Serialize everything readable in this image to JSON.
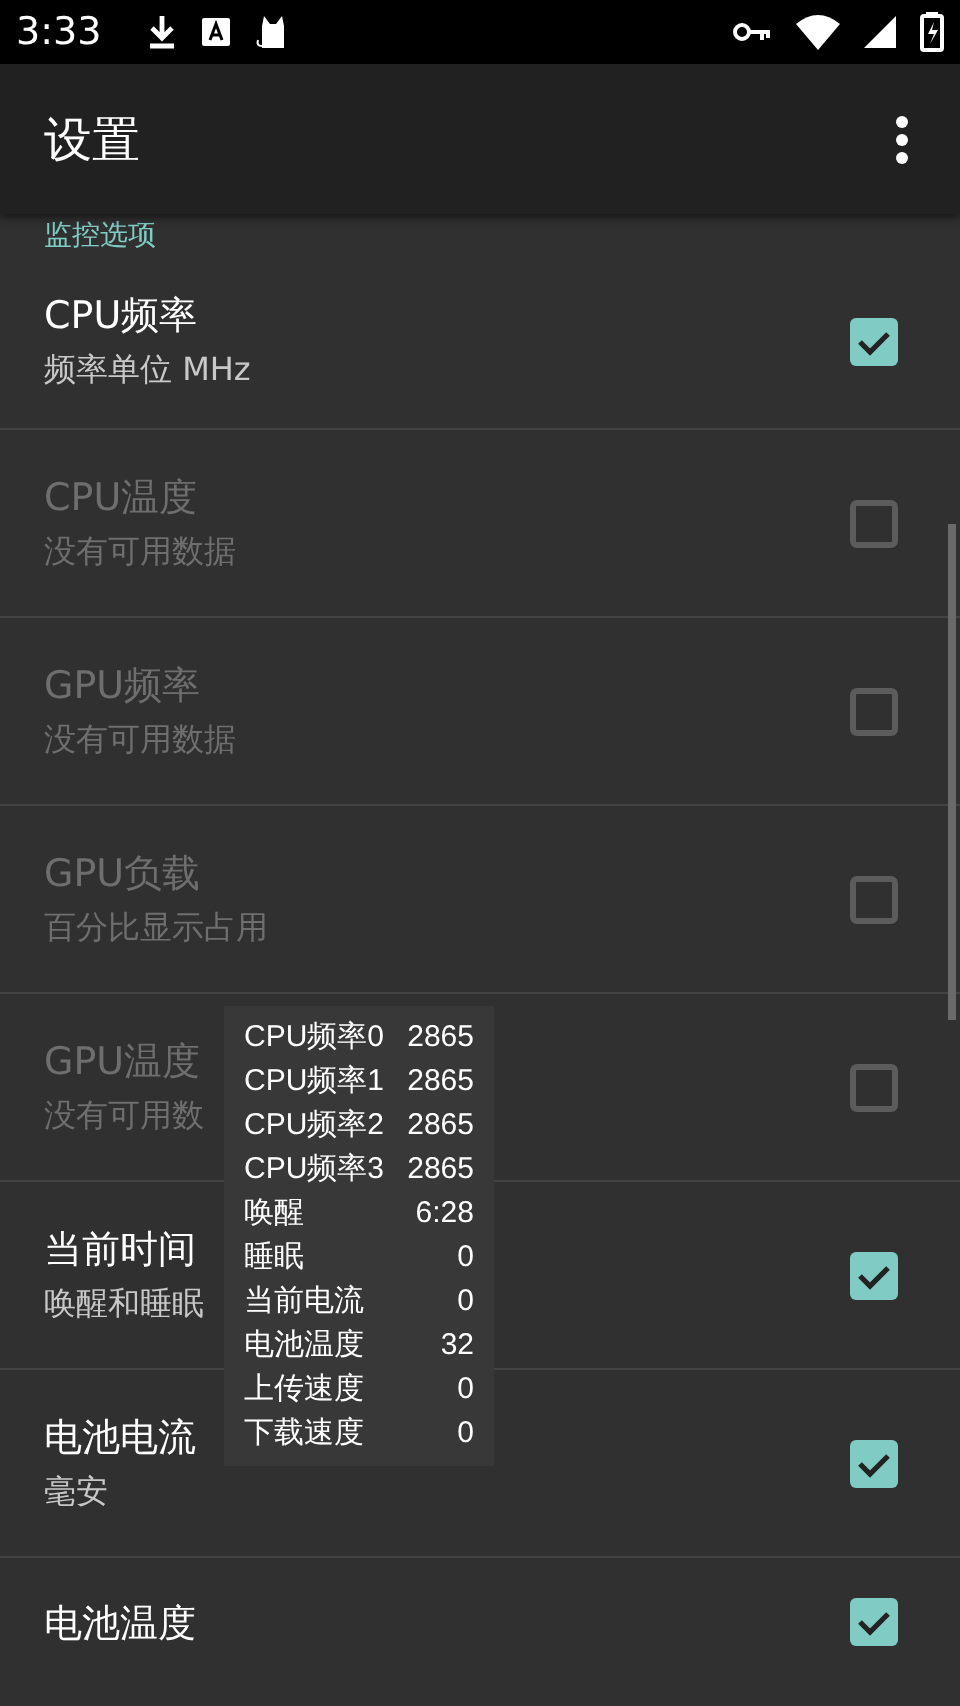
{
  "status_bar": {
    "time": "3:33"
  },
  "toolbar": {
    "title": "设置"
  },
  "section": {
    "title": "监控选项"
  },
  "settings": [
    {
      "title": "CPU频率",
      "subtitle": "频率单位 MHz",
      "checked": true,
      "disabled": false
    },
    {
      "title": "CPU温度",
      "subtitle": "没有可用数据",
      "checked": false,
      "disabled": true
    },
    {
      "title": "GPU频率",
      "subtitle": "没有可用数据",
      "checked": false,
      "disabled": true
    },
    {
      "title": "GPU负载",
      "subtitle": "百分比显示占用",
      "checked": false,
      "disabled": true
    },
    {
      "title": "GPU温度",
      "subtitle": "没有可用数",
      "checked": false,
      "disabled": true
    },
    {
      "title": "当前时间",
      "subtitle": "唤醒和睡眠",
      "checked": true,
      "disabled": false
    },
    {
      "title": "电池电流",
      "subtitle": "毫安",
      "checked": true,
      "disabled": false
    },
    {
      "title": "电池温度",
      "checked": true,
      "disabled": false
    }
  ],
  "overlay": [
    {
      "label": "CPU频率0",
      "value": "2865"
    },
    {
      "label": "CPU频率1",
      "value": "2865"
    },
    {
      "label": "CPU频率2",
      "value": "2865"
    },
    {
      "label": "CPU频率3",
      "value": "2865"
    },
    {
      "label": "唤醒",
      "value": "6:28"
    },
    {
      "label": "睡眠",
      "value": "0"
    },
    {
      "label": "当前电流",
      "value": "0"
    },
    {
      "label": "电池温度",
      "value": "32"
    },
    {
      "label": "上传速度",
      "value": "0"
    },
    {
      "label": "下载速度",
      "value": "0"
    }
  ]
}
